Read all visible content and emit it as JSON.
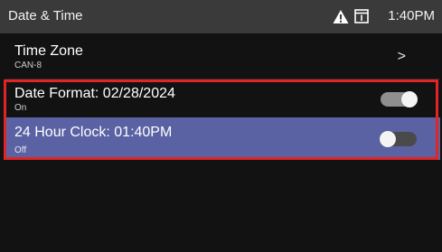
{
  "header": {
    "title": "Date & Time",
    "warning_icon": "warning-triangle-icon",
    "window_icon": "window-icon",
    "time": "1:40PM"
  },
  "settings": [
    {
      "label": "Time Zone",
      "value": "CAN-8",
      "control": "chevron-right-icon",
      "chevron": ">"
    },
    {
      "label": "Date Format: 02/28/2024",
      "value": "On",
      "control": "toggle",
      "toggle_on": true
    },
    {
      "label": "24 Hour Clock: 01:40PM",
      "value": "Off",
      "control": "toggle",
      "toggle_on": false,
      "selected": true
    }
  ],
  "colors": {
    "topbar_bg": "#3a3a3a",
    "background": "#121212",
    "selected_row": "#5a62a4",
    "highlight_border": "#e12424"
  }
}
